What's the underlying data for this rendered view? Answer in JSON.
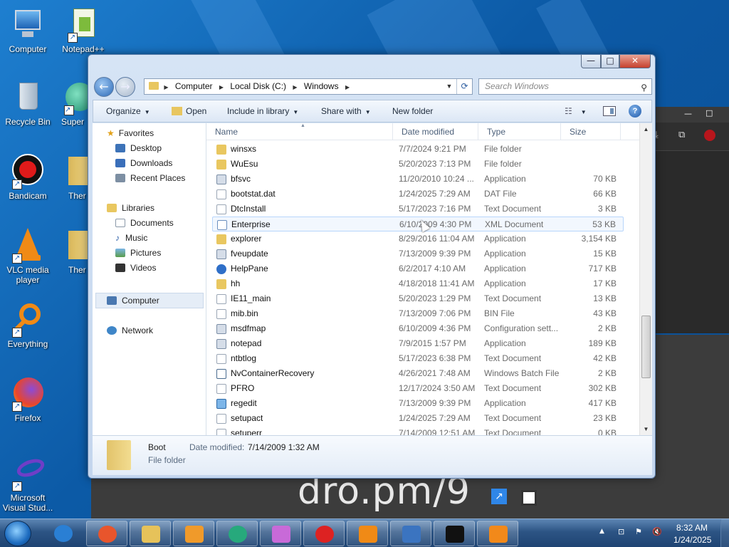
{
  "desktop": {
    "icons": [
      {
        "label": "Computer",
        "icon": "computer-icon"
      },
      {
        "label": "Notepad++",
        "icon": "notepadpp-icon"
      },
      {
        "label": "Recycle Bin",
        "icon": "recycle-bin-icon"
      },
      {
        "label": "Super",
        "icon": "app-icon"
      },
      {
        "label": "Bandicam",
        "icon": "bandicam-icon"
      },
      {
        "label": "Ther",
        "icon": "folder-icon"
      },
      {
        "label": "VLC media player",
        "icon": "vlc-icon"
      },
      {
        "label": "Ther",
        "icon": "folder-icon"
      },
      {
        "label": "Everything",
        "icon": "search-icon"
      },
      {
        "label": "Firefox",
        "icon": "firefox-icon"
      },
      {
        "label": "Microsoft Visual Stud...",
        "icon": "visual-studio-icon"
      }
    ],
    "overlay_text": "dro.pm/9"
  },
  "window": {
    "title": "Windows",
    "controls": {
      "minimize": "—",
      "maximize": "□",
      "close": "✕"
    },
    "breadcrumb": [
      "Computer",
      "Local Disk (C:)",
      "Windows"
    ],
    "search_placeholder": "Search Windows"
  },
  "toolbar": {
    "organize": "Organize",
    "open": "Open",
    "include_in_library": "Include in library",
    "share_with": "Share with",
    "new_folder": "New folder"
  },
  "navigation": {
    "favorites_header": "Favorites",
    "favorites": [
      "Desktop",
      "Downloads",
      "Recent Places"
    ],
    "libraries_header": "Libraries",
    "libraries": [
      "Documents",
      "Music",
      "Pictures",
      "Videos"
    ],
    "computer": "Computer",
    "network": "Network"
  },
  "columns": {
    "name": "Name",
    "date": "Date modified",
    "type": "Type",
    "size": "Size"
  },
  "files": [
    {
      "name": "winsxs",
      "date": "7/7/2024 9:21 PM",
      "type": "File folder",
      "size": "",
      "icon": "folder"
    },
    {
      "name": "WuEsu",
      "date": "5/20/2023 7:13 PM",
      "type": "File folder",
      "size": "",
      "icon": "folder"
    },
    {
      "name": "bfsvc",
      "date": "11/20/2010 10:24 ...",
      "type": "Application",
      "size": "70 KB",
      "icon": "app"
    },
    {
      "name": "bootstat.dat",
      "date": "1/24/2025 7:29 AM",
      "type": "DAT File",
      "size": "66 KB",
      "icon": "doc"
    },
    {
      "name": "DtcInstall",
      "date": "5/17/2023 7:16 PM",
      "type": "Text Document",
      "size": "3 KB",
      "icon": "doc"
    },
    {
      "name": "Enterprise",
      "date": "6/10/2009 4:30 PM",
      "type": "XML Document",
      "size": "53 KB",
      "icon": "xml"
    },
    {
      "name": "explorer",
      "date": "8/29/2016 11:04 AM",
      "type": "Application",
      "size": "3,154 KB",
      "icon": "folder"
    },
    {
      "name": "fveupdate",
      "date": "7/13/2009 9:39 PM",
      "type": "Application",
      "size": "15 KB",
      "icon": "app"
    },
    {
      "name": "HelpPane",
      "date": "6/2/2017 4:10 AM",
      "type": "Application",
      "size": "717 KB",
      "icon": "help"
    },
    {
      "name": "hh",
      "date": "4/18/2018 11:41 AM",
      "type": "Application",
      "size": "17 KB",
      "icon": "folder"
    },
    {
      "name": "IE11_main",
      "date": "5/20/2023 1:29 PM",
      "type": "Text Document",
      "size": "13 KB",
      "icon": "doc"
    },
    {
      "name": "mib.bin",
      "date": "7/13/2009 7:06 PM",
      "type": "BIN File",
      "size": "43 KB",
      "icon": "doc"
    },
    {
      "name": "msdfmap",
      "date": "6/10/2009 4:36 PM",
      "type": "Configuration sett...",
      "size": "2 KB",
      "icon": "app"
    },
    {
      "name": "notepad",
      "date": "7/9/2015 1:57 PM",
      "type": "Application",
      "size": "189 KB",
      "icon": "app"
    },
    {
      "name": "ntbtlog",
      "date": "5/17/2023 6:38 PM",
      "type": "Text Document",
      "size": "42 KB",
      "icon": "doc"
    },
    {
      "name": "NvContainerRecovery",
      "date": "4/26/2021 7:48 AM",
      "type": "Windows Batch File",
      "size": "2 KB",
      "icon": "bat"
    },
    {
      "name": "PFRO",
      "date": "12/17/2024 3:50 AM",
      "type": "Text Document",
      "size": "302 KB",
      "icon": "doc"
    },
    {
      "name": "regedit",
      "date": "7/13/2009 9:39 PM",
      "type": "Application",
      "size": "417 KB",
      "icon": "reg"
    },
    {
      "name": "setupact",
      "date": "1/24/2025 7:29 AM",
      "type": "Text Document",
      "size": "23 KB",
      "icon": "doc"
    },
    {
      "name": "setuperr",
      "date": "7/14/2009 12:51 AM",
      "type": "Text Document",
      "size": "0 KB",
      "icon": "doc"
    }
  ],
  "details": {
    "name": "Boot",
    "type": "File folder",
    "modified_label": "Date modified:",
    "modified_value": "7/14/2009 1:32 AM"
  },
  "taskbar": {
    "apps": [
      "ie-icon",
      "firefox-icon",
      "explorer-icon",
      "video-icon",
      "chat-icon",
      "paint-icon",
      "record-icon",
      "vlc-icon",
      "remote-desktop-icon",
      "cmd-icon",
      "blender-icon"
    ],
    "time": "8:32 AM",
    "date": "1/24/2025"
  }
}
